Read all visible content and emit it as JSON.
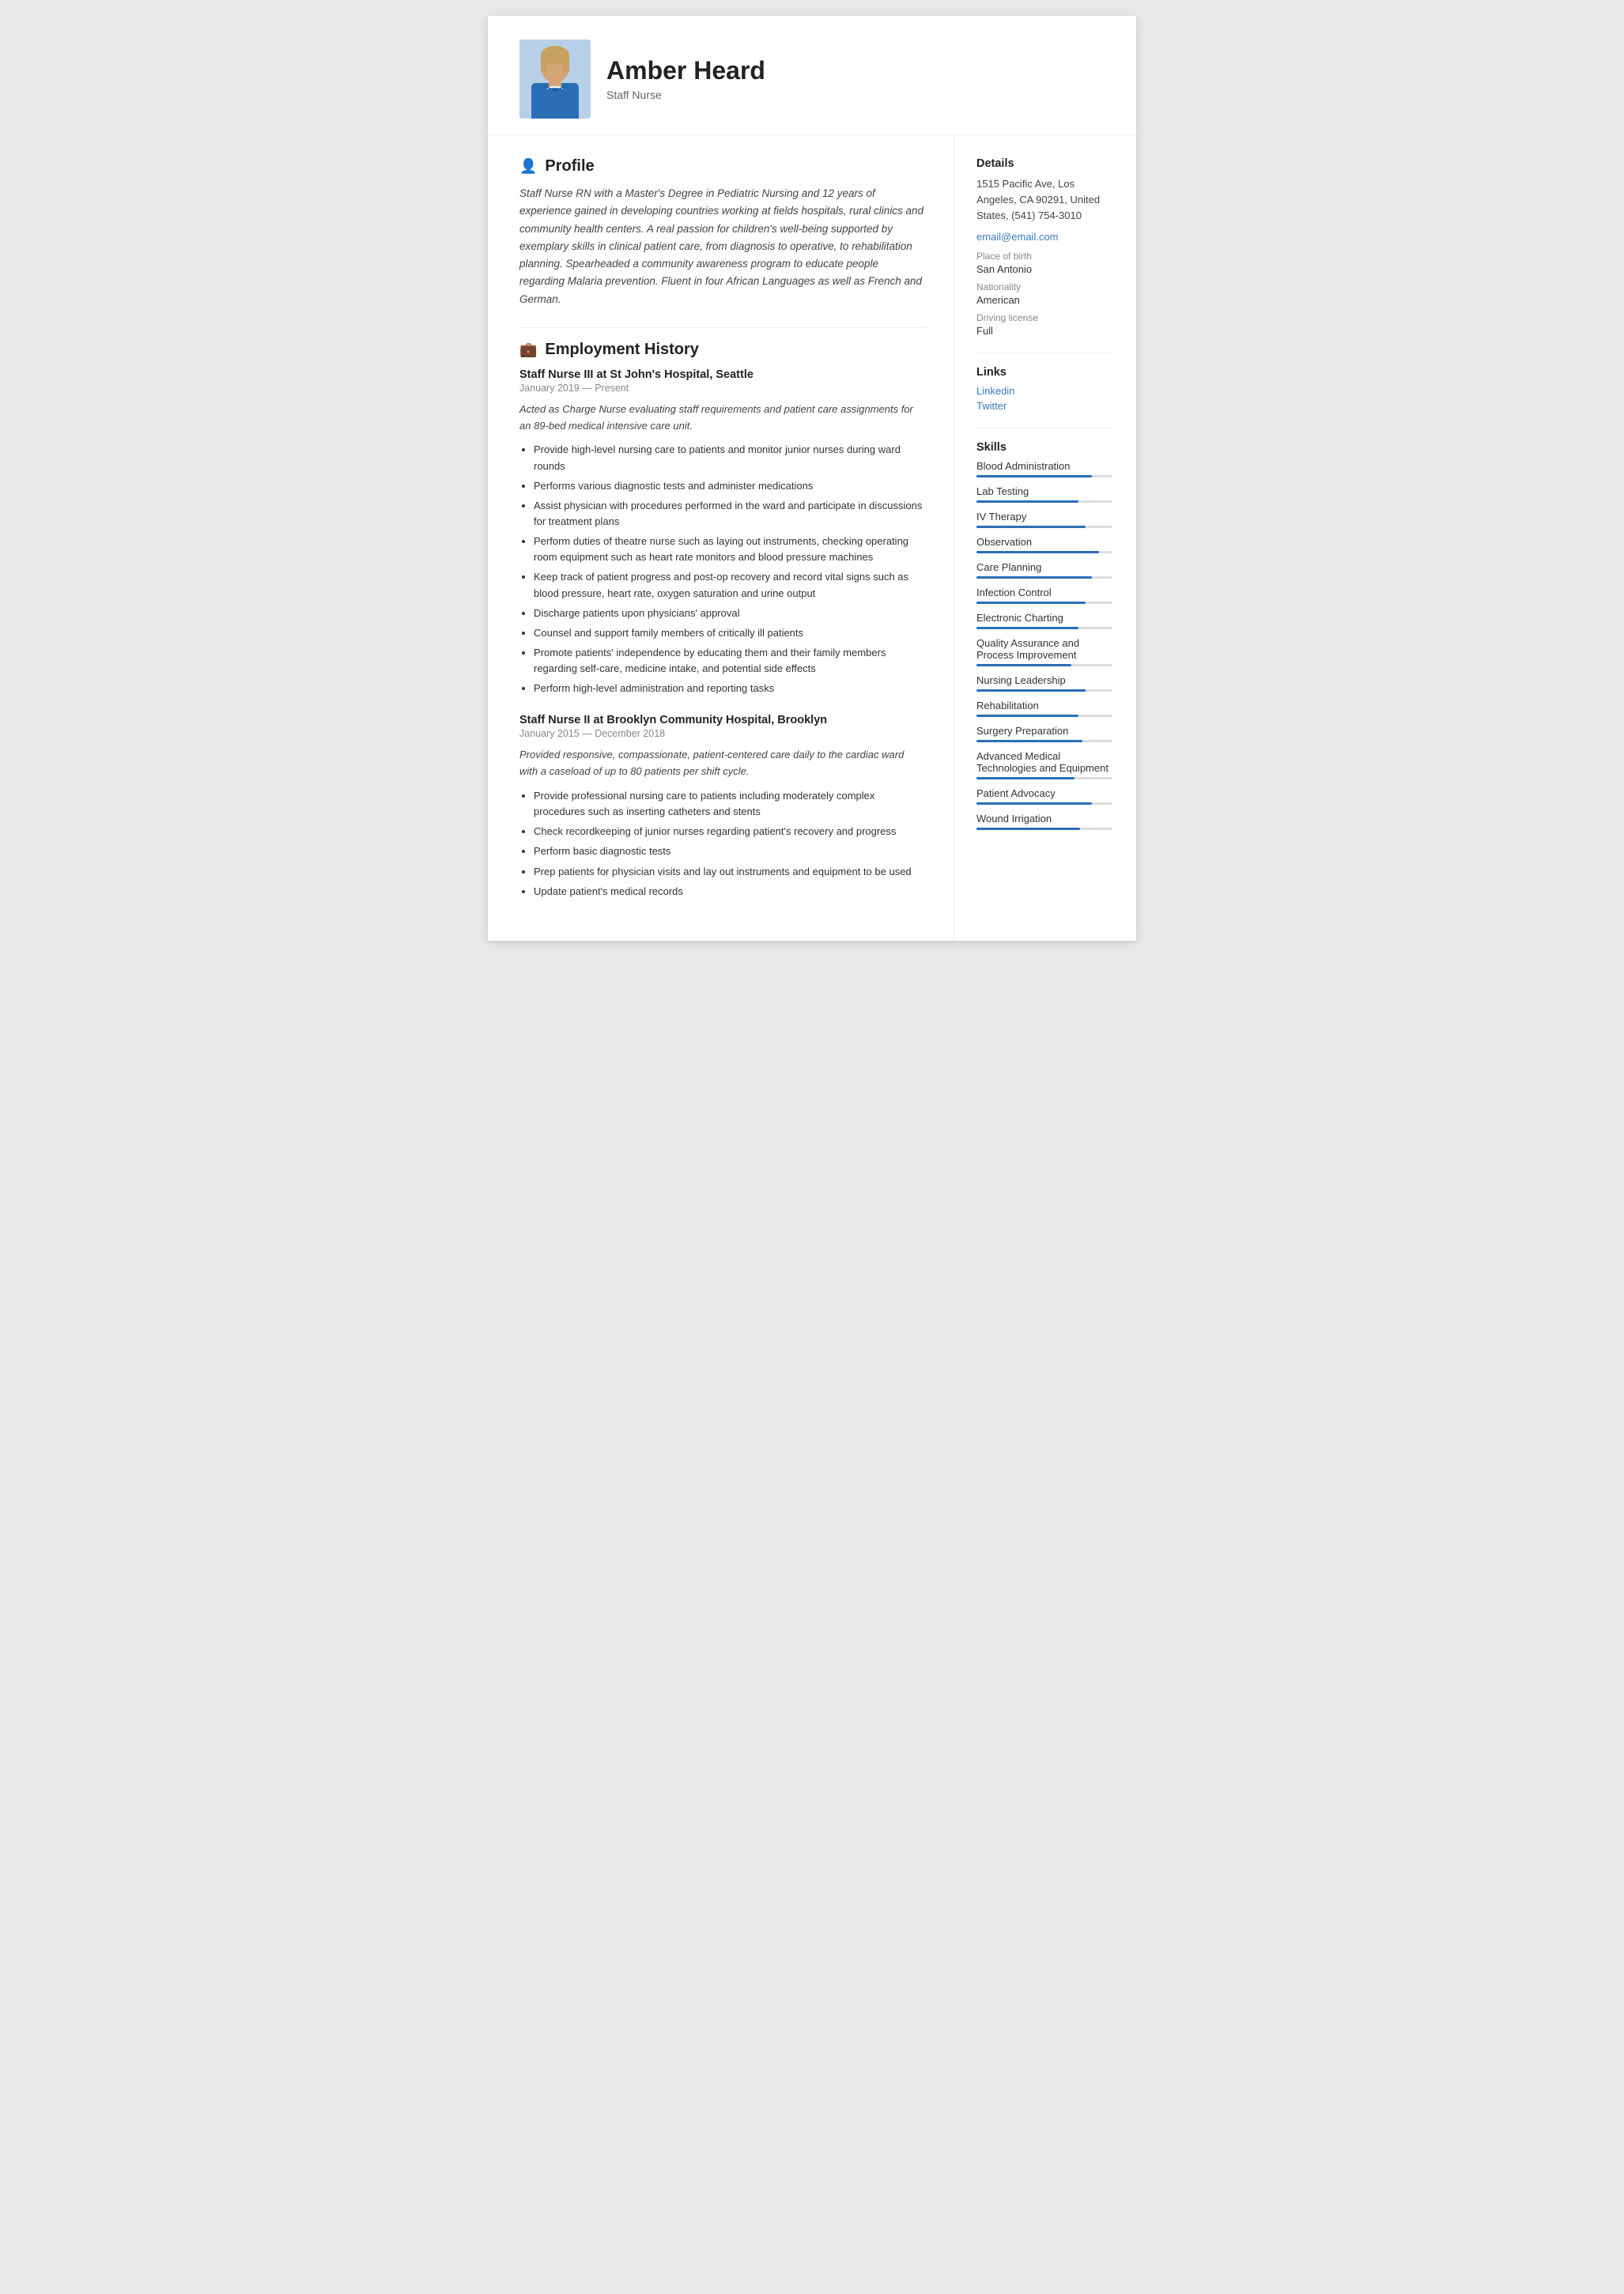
{
  "header": {
    "name": "Amber Heard",
    "title": "Staff Nurse"
  },
  "profile": {
    "heading": "Profile",
    "icon": "👤",
    "text": "Staff Nurse RN with a Master's Degree in Pediatric Nursing and 12 years of experience gained in developing countries working at fields hospitals, rural clinics and community health centers. A real passion for children's well-being supported by exemplary skills in clinical patient care, from diagnosis to operative, to rehabilitation planning. Spearheaded a community awareness program to educate people regarding Malaria prevention. Fluent in four African Languages as well as French and German."
  },
  "employment": {
    "heading": "Employment History",
    "icon": "💼",
    "jobs": [
      {
        "title": "Staff Nurse III at  St John's Hospital, Seattle",
        "date": "January 2019 — Present",
        "description": "Acted as Charge Nurse evaluating staff requirements and patient care assignments for an 89-bed medical intensive care unit.",
        "bullets": [
          "Provide high-level nursing care to patients and monitor junior nurses during ward rounds",
          "Performs various diagnostic tests and administer medications",
          "Assist physician with procedures performed in the ward and participate in discussions for treatment plans",
          "Perform duties of theatre nurse such as laying out instruments, checking operating room equipment such as heart rate monitors and blood pressure machines",
          "Keep track of patient progress and post-op recovery and record vital signs such as blood pressure, heart rate, oxygen saturation and urine output",
          "Discharge patients upon physicians' approval",
          "Counsel and support family members of critically ill patients",
          "Promote patients' independence by educating them and their family members regarding self-care, medicine intake, and potential side effects",
          "Perform high-level administration and reporting tasks"
        ]
      },
      {
        "title": "Staff Nurse II at  Brooklyn Community Hospital, Brooklyn",
        "date": "January 2015 — December 2018",
        "description": "Provided responsive, compassionate, patient-centered care daily to the cardiac ward with a caseload of up to 80 patients per shift cycle.",
        "bullets": [
          "Provide professional nursing care to patients including moderately complex procedures such as inserting catheters and stents",
          "Check recordkeeping of junior nurses regarding patient's recovery and progress",
          "Perform basic diagnostic tests",
          "Prep patients for physician visits and lay out instruments and equipment to be used",
          "Update patient's medical records"
        ]
      }
    ]
  },
  "details": {
    "heading": "Details",
    "address": "1515 Pacific Ave, Los Angeles, CA 90291, United States, (541) 754-3010",
    "email": "email@email.com",
    "place_of_birth_label": "Place of birth",
    "place_of_birth": "San Antonio",
    "nationality_label": "Nationality",
    "nationality": "American",
    "driving_license_label": "Driving license",
    "driving_license": "Full"
  },
  "links": {
    "heading": "Links",
    "items": [
      {
        "label": "Linkedin",
        "url": "#"
      },
      {
        "label": "Twitter",
        "url": "#"
      }
    ]
  },
  "skills": {
    "heading": "Skills",
    "items": [
      {
        "name": "Blood Administration",
        "level": 85
      },
      {
        "name": "Lab Testing",
        "level": 75
      },
      {
        "name": "IV Therapy",
        "level": 80
      },
      {
        "name": "Observation",
        "level": 90
      },
      {
        "name": "Care Planning",
        "level": 85
      },
      {
        "name": "Infection Control",
        "level": 80
      },
      {
        "name": "Electronic Charting",
        "level": 75
      },
      {
        "name": "Quality Assurance and Process Improvement",
        "level": 70
      },
      {
        "name": "Nursing Leadership",
        "level": 80
      },
      {
        "name": "Rehabilitation",
        "level": 75
      },
      {
        "name": "Surgery Preparation",
        "level": 78
      },
      {
        "name": "Advanced Medical Technologies and Equipment",
        "level": 72
      },
      {
        "name": "Patient Advocacy",
        "level": 85
      },
      {
        "name": "Wound Irrigation",
        "level": 76
      }
    ]
  }
}
